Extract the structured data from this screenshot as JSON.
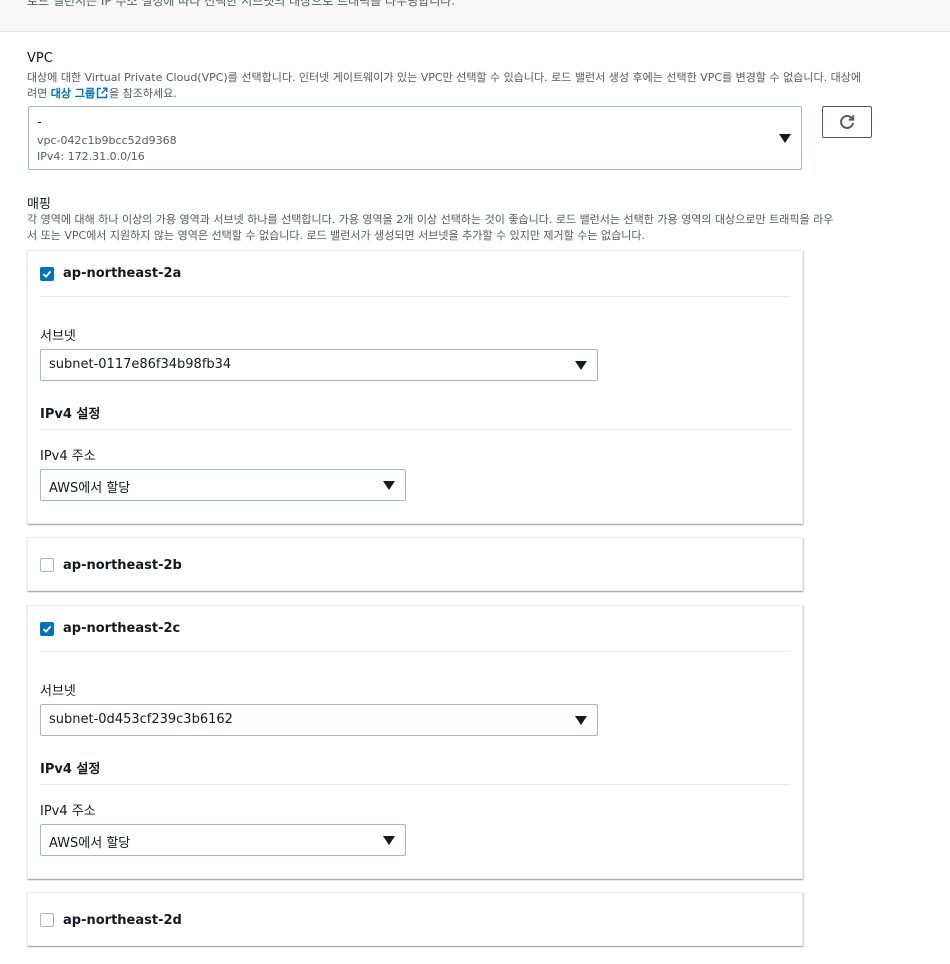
{
  "top": {
    "cut_text": "로드 밸런서는 IP 주소 설정에 따라 선택한 서브넷의 대상으로 트래픽을 라우팅합니다."
  },
  "vpc": {
    "title": "VPC",
    "desc_line1": "대상에 대한 Virtual Private Cloud(VPC)를 선택합니다. 인터넷 게이트웨이가 있는 VPC만 선택할 수 있습니다. 로드 밸런서 생성 후에는 선택한 VPC를 변경할 수 없습니다. 대상에",
    "desc_line2_pre": "려면",
    "desc_link": "대상 그룹",
    "desc_line2_post": "을 참조하세요.",
    "selected_name": "-",
    "selected_id": "vpc-042c1b9bcc52d9368",
    "selected_cidr": "IPv4: 172.31.0.0/16"
  },
  "mapping": {
    "title": "매핑",
    "desc_line1": "각 영역에 대해 하나 이상의 가용 영역과 서브넷 하나를 선택합니다. 가용 영역을 2개 이상 선택하는 것이 좋습니다. 로드 밸런서는 선택한 가용 영역의 대상으로만 트래픽을 라우",
    "desc_line2": "서 또는 VPC에서 지원하지 않는 영역은 선택할 수 없습니다. 로드 밸런서가 생성되면 서브넷을 추가할 수 있지만 제거할 수는 없습니다."
  },
  "zones": [
    {
      "label": "ap-northeast-2a",
      "checked": true,
      "subnet_label": "서브넷",
      "subnet_value": "subnet-0117e86f34b98fb34",
      "ipv4_section": "IPv4 설정",
      "ipv4_label": "IPv4 주소",
      "ipv4_value": "AWS에서 할당"
    },
    {
      "label": "ap-northeast-2b",
      "checked": false
    },
    {
      "label": "ap-northeast-2c",
      "checked": true,
      "subnet_label": "서브넷",
      "subnet_value": "subnet-0d453cf239c3b6162",
      "ipv4_section": "IPv4 설정",
      "ipv4_label": "IPv4 주소",
      "ipv4_value": "AWS에서 할당"
    },
    {
      "label": "ap-northeast-2d",
      "checked": false
    }
  ],
  "colors": {
    "accent": "#0073bb",
    "border": "#aab7b8",
    "text": "#16191f",
    "muted": "#545b64"
  },
  "icons": {
    "refresh": "refresh-icon",
    "external_link": "external-link-icon",
    "checkbox_checked": "check-icon",
    "dropdown": "caret-down-icon"
  }
}
